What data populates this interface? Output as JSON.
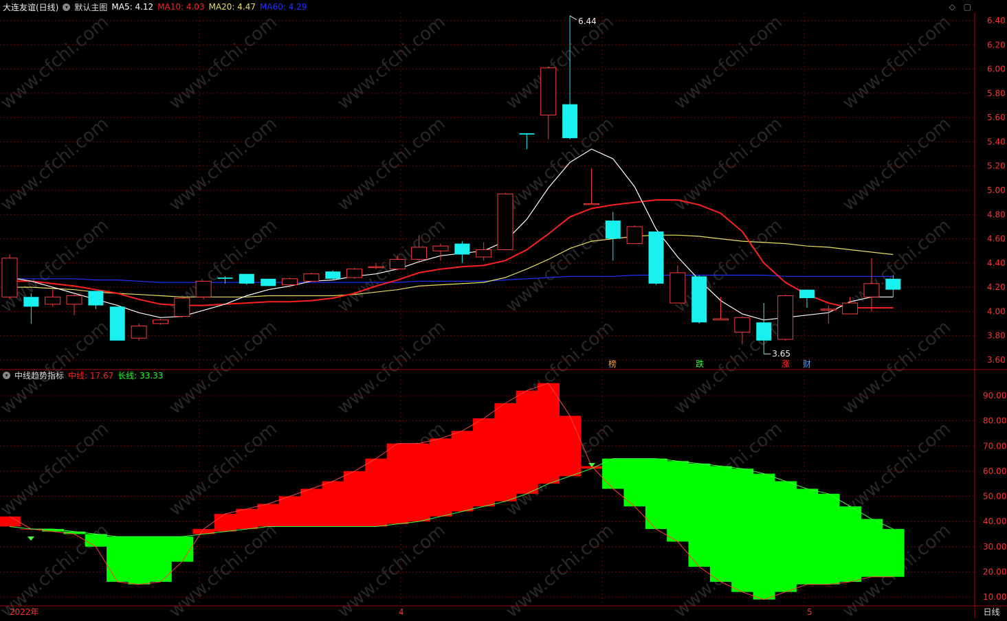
{
  "header": {
    "stock_name": "大连友谊(日线)",
    "main_chart_label": "默认主图",
    "ma5_label": "MA5: 4.12",
    "ma10_label": "MA10: 4.03",
    "ma20_label": "MA20: 4.47",
    "ma60_label": "MA60: 4.29"
  },
  "indicator_header": {
    "name": "中线趋势指标",
    "mid_label": "中线: 17.67",
    "long_label": "长线: 33.33"
  },
  "colors": {
    "up": "#ff3b3b",
    "down": "#19f0f0",
    "ma5": "#ffffff",
    "ma10": "#ff2020",
    "ma20": "#e8e060",
    "ma60": "#2030ff",
    "grid": "#7a0000",
    "axis_text": "#ff3030",
    "red_fill": "#ff0000",
    "green_fill": "#00ff00"
  },
  "price_axis": [
    "6.40",
    "6.20",
    "6.00",
    "5.80",
    "5.60",
    "5.40",
    "5.20",
    "5.00",
    "4.80",
    "4.60",
    "4.40",
    "4.20",
    "4.00",
    "3.80",
    "3.60"
  ],
  "indicator_axis": [
    "90.00",
    "80.00",
    "70.00",
    "60.00",
    "50.00",
    "40.00",
    "30.00",
    "20.00",
    "10.00"
  ],
  "x_axis": [
    "2022年",
    "4",
    "5"
  ],
  "period_label": "日线",
  "annotations": {
    "high": "6.44",
    "low": "3.65"
  },
  "event_markers": [
    "榜",
    "跌",
    "涨",
    "财"
  ],
  "watermark": "www.cfchi.com",
  "chart_data": {
    "type": "candlestick",
    "ylim": [
      3.55,
      6.52
    ],
    "candles": [
      {
        "o": 4.12,
        "h": 4.47,
        "l": 4.1,
        "c": 4.44
      },
      {
        "o": 4.12,
        "h": 4.15,
        "l": 3.9,
        "c": 4.04
      },
      {
        "o": 4.06,
        "h": 4.18,
        "l": 4.04,
        "c": 4.12
      },
      {
        "o": 4.06,
        "h": 4.15,
        "l": 3.97,
        "c": 4.13
      },
      {
        "o": 4.17,
        "h": 4.17,
        "l": 4.02,
        "c": 4.05
      },
      {
        "o": 4.04,
        "h": 4.04,
        "l": 3.76,
        "c": 3.76
      },
      {
        "o": 3.78,
        "h": 3.9,
        "l": 3.76,
        "c": 3.88
      },
      {
        "o": 3.9,
        "h": 3.94,
        "l": 3.89,
        "c": 3.93
      },
      {
        "o": 3.96,
        "h": 4.12,
        "l": 3.95,
        "c": 4.11
      },
      {
        "o": 4.12,
        "h": 4.25,
        "l": 4.1,
        "c": 4.25
      },
      {
        "o": 4.28,
        "h": 4.29,
        "l": 4.23,
        "c": 4.27
      },
      {
        "o": 4.31,
        "h": 4.31,
        "l": 4.22,
        "c": 4.23
      },
      {
        "o": 4.27,
        "h": 4.27,
        "l": 4.21,
        "c": 4.21
      },
      {
        "o": 4.22,
        "h": 4.28,
        "l": 4.2,
        "c": 4.27
      },
      {
        "o": 4.25,
        "h": 4.32,
        "l": 4.24,
        "c": 4.31
      },
      {
        "o": 4.33,
        "h": 4.34,
        "l": 4.26,
        "c": 4.27
      },
      {
        "o": 4.28,
        "h": 4.36,
        "l": 4.27,
        "c": 4.35
      },
      {
        "o": 4.37,
        "h": 4.4,
        "l": 4.35,
        "c": 4.37
      },
      {
        "o": 4.35,
        "h": 4.46,
        "l": 4.34,
        "c": 4.43
      },
      {
        "o": 4.43,
        "h": 4.63,
        "l": 4.4,
        "c": 4.53
      },
      {
        "o": 4.5,
        "h": 4.56,
        "l": 4.42,
        "c": 4.54
      },
      {
        "o": 4.56,
        "h": 4.58,
        "l": 4.4,
        "c": 4.47
      },
      {
        "o": 4.45,
        "h": 4.57,
        "l": 4.42,
        "c": 4.51
      },
      {
        "o": 4.51,
        "h": 4.98,
        "l": 4.51,
        "c": 4.97
      },
      {
        "o": 5.47,
        "h": 5.47,
        "l": 5.34,
        "c": 5.46
      },
      {
        "o": 5.62,
        "h": 6.02,
        "l": 5.42,
        "c": 6.01
      },
      {
        "o": 5.71,
        "h": 6.44,
        "l": 5.42,
        "c": 5.43
      },
      {
        "o": 4.89,
        "h": 5.18,
        "l": 4.89,
        "c": 4.89
      },
      {
        "o": 4.75,
        "h": 4.82,
        "l": 4.42,
        "c": 4.6
      },
      {
        "o": 4.56,
        "h": 4.71,
        "l": 4.56,
        "c": 4.7
      },
      {
        "o": 4.66,
        "h": 4.66,
        "l": 4.22,
        "c": 4.23
      },
      {
        "o": 4.07,
        "h": 4.38,
        "l": 4.07,
        "c": 4.32
      },
      {
        "o": 4.29,
        "h": 4.3,
        "l": 3.9,
        "c": 3.91
      },
      {
        "o": 3.93,
        "h": 4.12,
        "l": 3.93,
        "c": 3.94
      },
      {
        "o": 3.83,
        "h": 3.96,
        "l": 3.73,
        "c": 3.95
      },
      {
        "o": 3.91,
        "h": 4.07,
        "l": 3.65,
        "c": 3.76
      },
      {
        "o": 3.77,
        "h": 4.14,
        "l": 3.76,
        "c": 4.13
      },
      {
        "o": 4.18,
        "h": 4.18,
        "l": 4.03,
        "c": 4.11
      },
      {
        "o": 4.02,
        "h": 4.05,
        "l": 3.9,
        "c": 4.02
      },
      {
        "o": 3.98,
        "h": 4.12,
        "l": 3.98,
        "c": 4.07
      },
      {
        "o": 4.12,
        "h": 4.44,
        "l": 4.0,
        "c": 4.23
      },
      {
        "o": 4.27,
        "h": 4.3,
        "l": 4.12,
        "c": 4.18
      }
    ],
    "ma5": [
      4.28,
      4.25,
      4.2,
      4.15,
      4.1,
      4.05,
      3.99,
      3.95,
      3.96,
      4.01,
      4.06,
      4.13,
      4.18,
      4.21,
      4.25,
      4.26,
      4.29,
      4.31,
      4.35,
      4.41,
      4.46,
      4.48,
      4.5,
      4.58,
      4.76,
      5.02,
      5.23,
      5.34,
      5.26,
      5.03,
      4.68,
      4.45,
      4.26,
      4.09,
      3.98,
      3.93,
      3.95,
      3.97,
      3.99,
      4.08,
      4.12,
      4.12
    ],
    "ma10": [
      4.25,
      4.25,
      4.23,
      4.21,
      4.18,
      4.15,
      4.1,
      4.06,
      4.05,
      4.05,
      4.06,
      4.07,
      4.08,
      4.08,
      4.09,
      4.11,
      4.15,
      4.21,
      4.26,
      4.32,
      4.35,
      4.37,
      4.38,
      4.42,
      4.51,
      4.64,
      4.78,
      4.85,
      4.88,
      4.9,
      4.92,
      4.92,
      4.88,
      4.81,
      4.66,
      4.4,
      4.24,
      4.14,
      4.07,
      4.03,
      4.03,
      4.03
    ],
    "ma20": [
      4.2,
      4.2,
      4.19,
      4.18,
      4.16,
      4.15,
      4.14,
      4.13,
      4.12,
      4.12,
      4.12,
      4.12,
      4.13,
      4.13,
      4.13,
      4.13,
      4.14,
      4.16,
      4.18,
      4.21,
      4.22,
      4.23,
      4.24,
      4.28,
      4.35,
      4.43,
      4.52,
      4.58,
      4.6,
      4.62,
      4.63,
      4.63,
      4.62,
      4.6,
      4.58,
      4.57,
      4.56,
      4.54,
      4.53,
      4.51,
      4.49,
      4.47
    ],
    "ma60": [
      4.27,
      4.27,
      4.27,
      4.27,
      4.26,
      4.26,
      4.25,
      4.24,
      4.24,
      4.24,
      4.24,
      4.24,
      4.24,
      4.24,
      4.24,
      4.24,
      4.24,
      4.24,
      4.24,
      4.25,
      4.25,
      4.25,
      4.25,
      4.26,
      4.27,
      4.28,
      4.29,
      4.29,
      4.29,
      4.3,
      4.3,
      4.3,
      4.3,
      4.3,
      4.3,
      4.3,
      4.29,
      4.29,
      4.29,
      4.29,
      4.29,
      4.29
    ],
    "indicator": {
      "ylim": [
        5,
        99
      ],
      "mid": [
        42,
        37,
        36,
        35,
        30,
        16,
        15,
        16,
        24,
        37,
        43,
        45,
        47,
        50,
        53,
        56,
        60,
        65,
        71,
        71,
        73,
        76,
        81,
        87,
        92,
        95,
        82,
        62,
        53,
        46,
        37,
        32,
        22,
        16,
        12,
        9,
        12,
        15,
        15,
        16,
        18,
        18
      ],
      "long": [
        38,
        37,
        37,
        36,
        35,
        34,
        34,
        34,
        34,
        35,
        36,
        37,
        38,
        38,
        38,
        38,
        38,
        38,
        39,
        40,
        42,
        44,
        46,
        48,
        51,
        55,
        58,
        61,
        65,
        65,
        65,
        64,
        63,
        62,
        61,
        59,
        56,
        53,
        51,
        46,
        41,
        37,
        33
      ]
    }
  }
}
